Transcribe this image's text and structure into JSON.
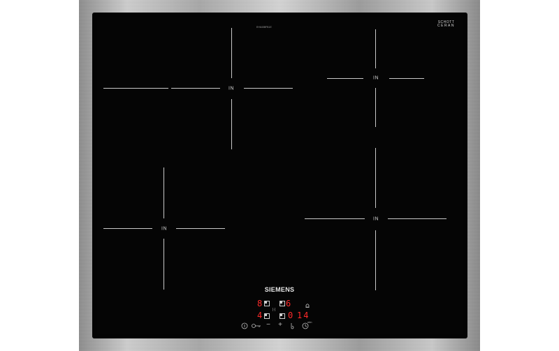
{
  "hob": {
    "model_code": "EH645BFB1E",
    "brand": "SIEMENS",
    "glass_maker": "SCHOTT",
    "glass_type": "CERAN",
    "zone_label": "IN"
  },
  "display": {
    "zone1_level": "8",
    "zone2_level": "6",
    "zone3_level": "4",
    "timer_digit_a": "0",
    "timer_digit_b": "14",
    "timer_unit": "min"
  },
  "controls": {
    "power_icon": "power-icon",
    "lock_icon": "key-lock-icon",
    "minus_label": "−",
    "plus_label": "+",
    "boost_icon": "boost-icon",
    "timer_icon": "clock-icon",
    "alarm_icon": "bell-icon"
  },
  "colors": {
    "glass": "#050505",
    "display_red": "#ff2a2a",
    "markings": "#c9c9c9"
  }
}
